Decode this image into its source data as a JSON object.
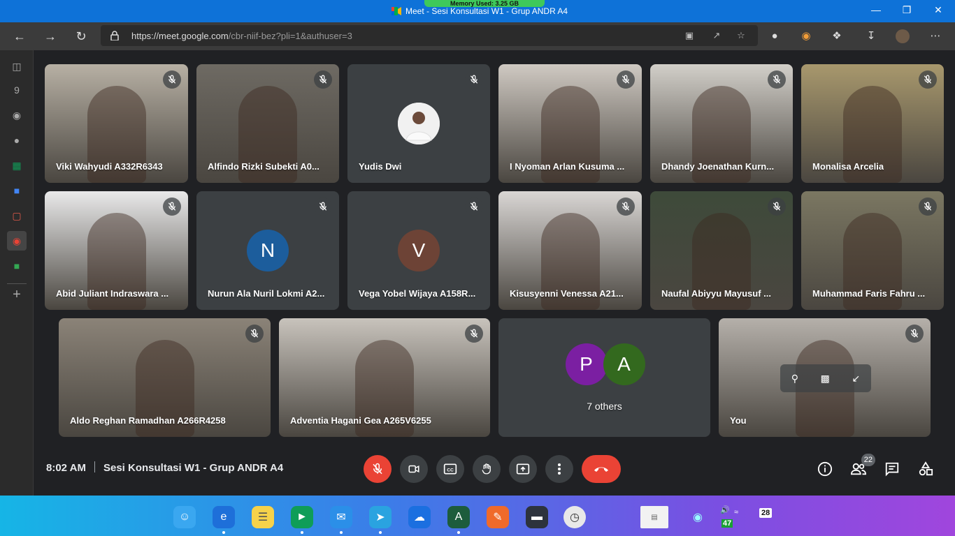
{
  "window": {
    "title": "Meet - Sesi Konsultasi W1 - Grup ANDR A4",
    "memory_badge": "Memory Used: 3.25 GB"
  },
  "browser": {
    "url_host": "https://meet.google.com",
    "url_path": "/cbr-niif-bez?pli=1&authuser=3"
  },
  "participants": [
    {
      "name": "Viki Wahyudi A332R6343",
      "type": "video",
      "bg": "#b7b0a4"
    },
    {
      "name": "Alfindo Rizki Subekti A0...",
      "type": "video",
      "bg": "#6e6a63"
    },
    {
      "name": "Yudis Dwi",
      "type": "photo",
      "bg": "#3c4043"
    },
    {
      "name": "I Nyoman Arlan Kusuma ...",
      "type": "video",
      "bg": "#cfc9c2"
    },
    {
      "name": "Dhandy Joenathan Kurn...",
      "type": "video",
      "bg": "#d2cfc9"
    },
    {
      "name": "Monalisa Arcelia",
      "type": "video",
      "bg": "#a8986d"
    },
    {
      "name": "Abid Juliant Indraswara ...",
      "type": "video",
      "bg": "#e9e9ea"
    },
    {
      "name": "Nurun Ala Nuril Lokmi A2...",
      "type": "initial",
      "initial": "N",
      "color": "#1c5d9c"
    },
    {
      "name": "Vega Yobel Wijaya A158R...",
      "type": "initial",
      "initial": "V",
      "color": "#6d4336"
    },
    {
      "name": "Kisusyenni Venessa A21...",
      "type": "video",
      "bg": "#d9d6d4"
    },
    {
      "name": "Naufal Abiyyu Mayusuf ...",
      "type": "video",
      "bg": "#3e4a3a"
    },
    {
      "name": "Muhammad Faris Fahru ...",
      "type": "video",
      "bg": "#7b7762"
    },
    {
      "name": "Aldo Reghan Ramadhan A266R4258",
      "type": "video",
      "bg": "#8b8378"
    },
    {
      "name": "Adventia Hagani Gea A265V6255",
      "type": "video",
      "bg": "#c8c3bc"
    },
    {
      "name": "7 others",
      "type": "others",
      "initials": [
        "P",
        "A"
      ],
      "colors": [
        "#7b1fa2",
        "#33691e"
      ]
    },
    {
      "name": "You",
      "type": "video",
      "bg": "#b5b0aa"
    }
  ],
  "meeting": {
    "time": "8:02 AM",
    "title": "Sesi Konsultasi W1 - Grup ANDR A4",
    "participant_count": "22"
  },
  "tray": {
    "volume": "47",
    "date": "28"
  },
  "colors": {
    "accent_red": "#ea4335",
    "meet_bg": "#202124",
    "tile_bg": "#3c4043"
  }
}
